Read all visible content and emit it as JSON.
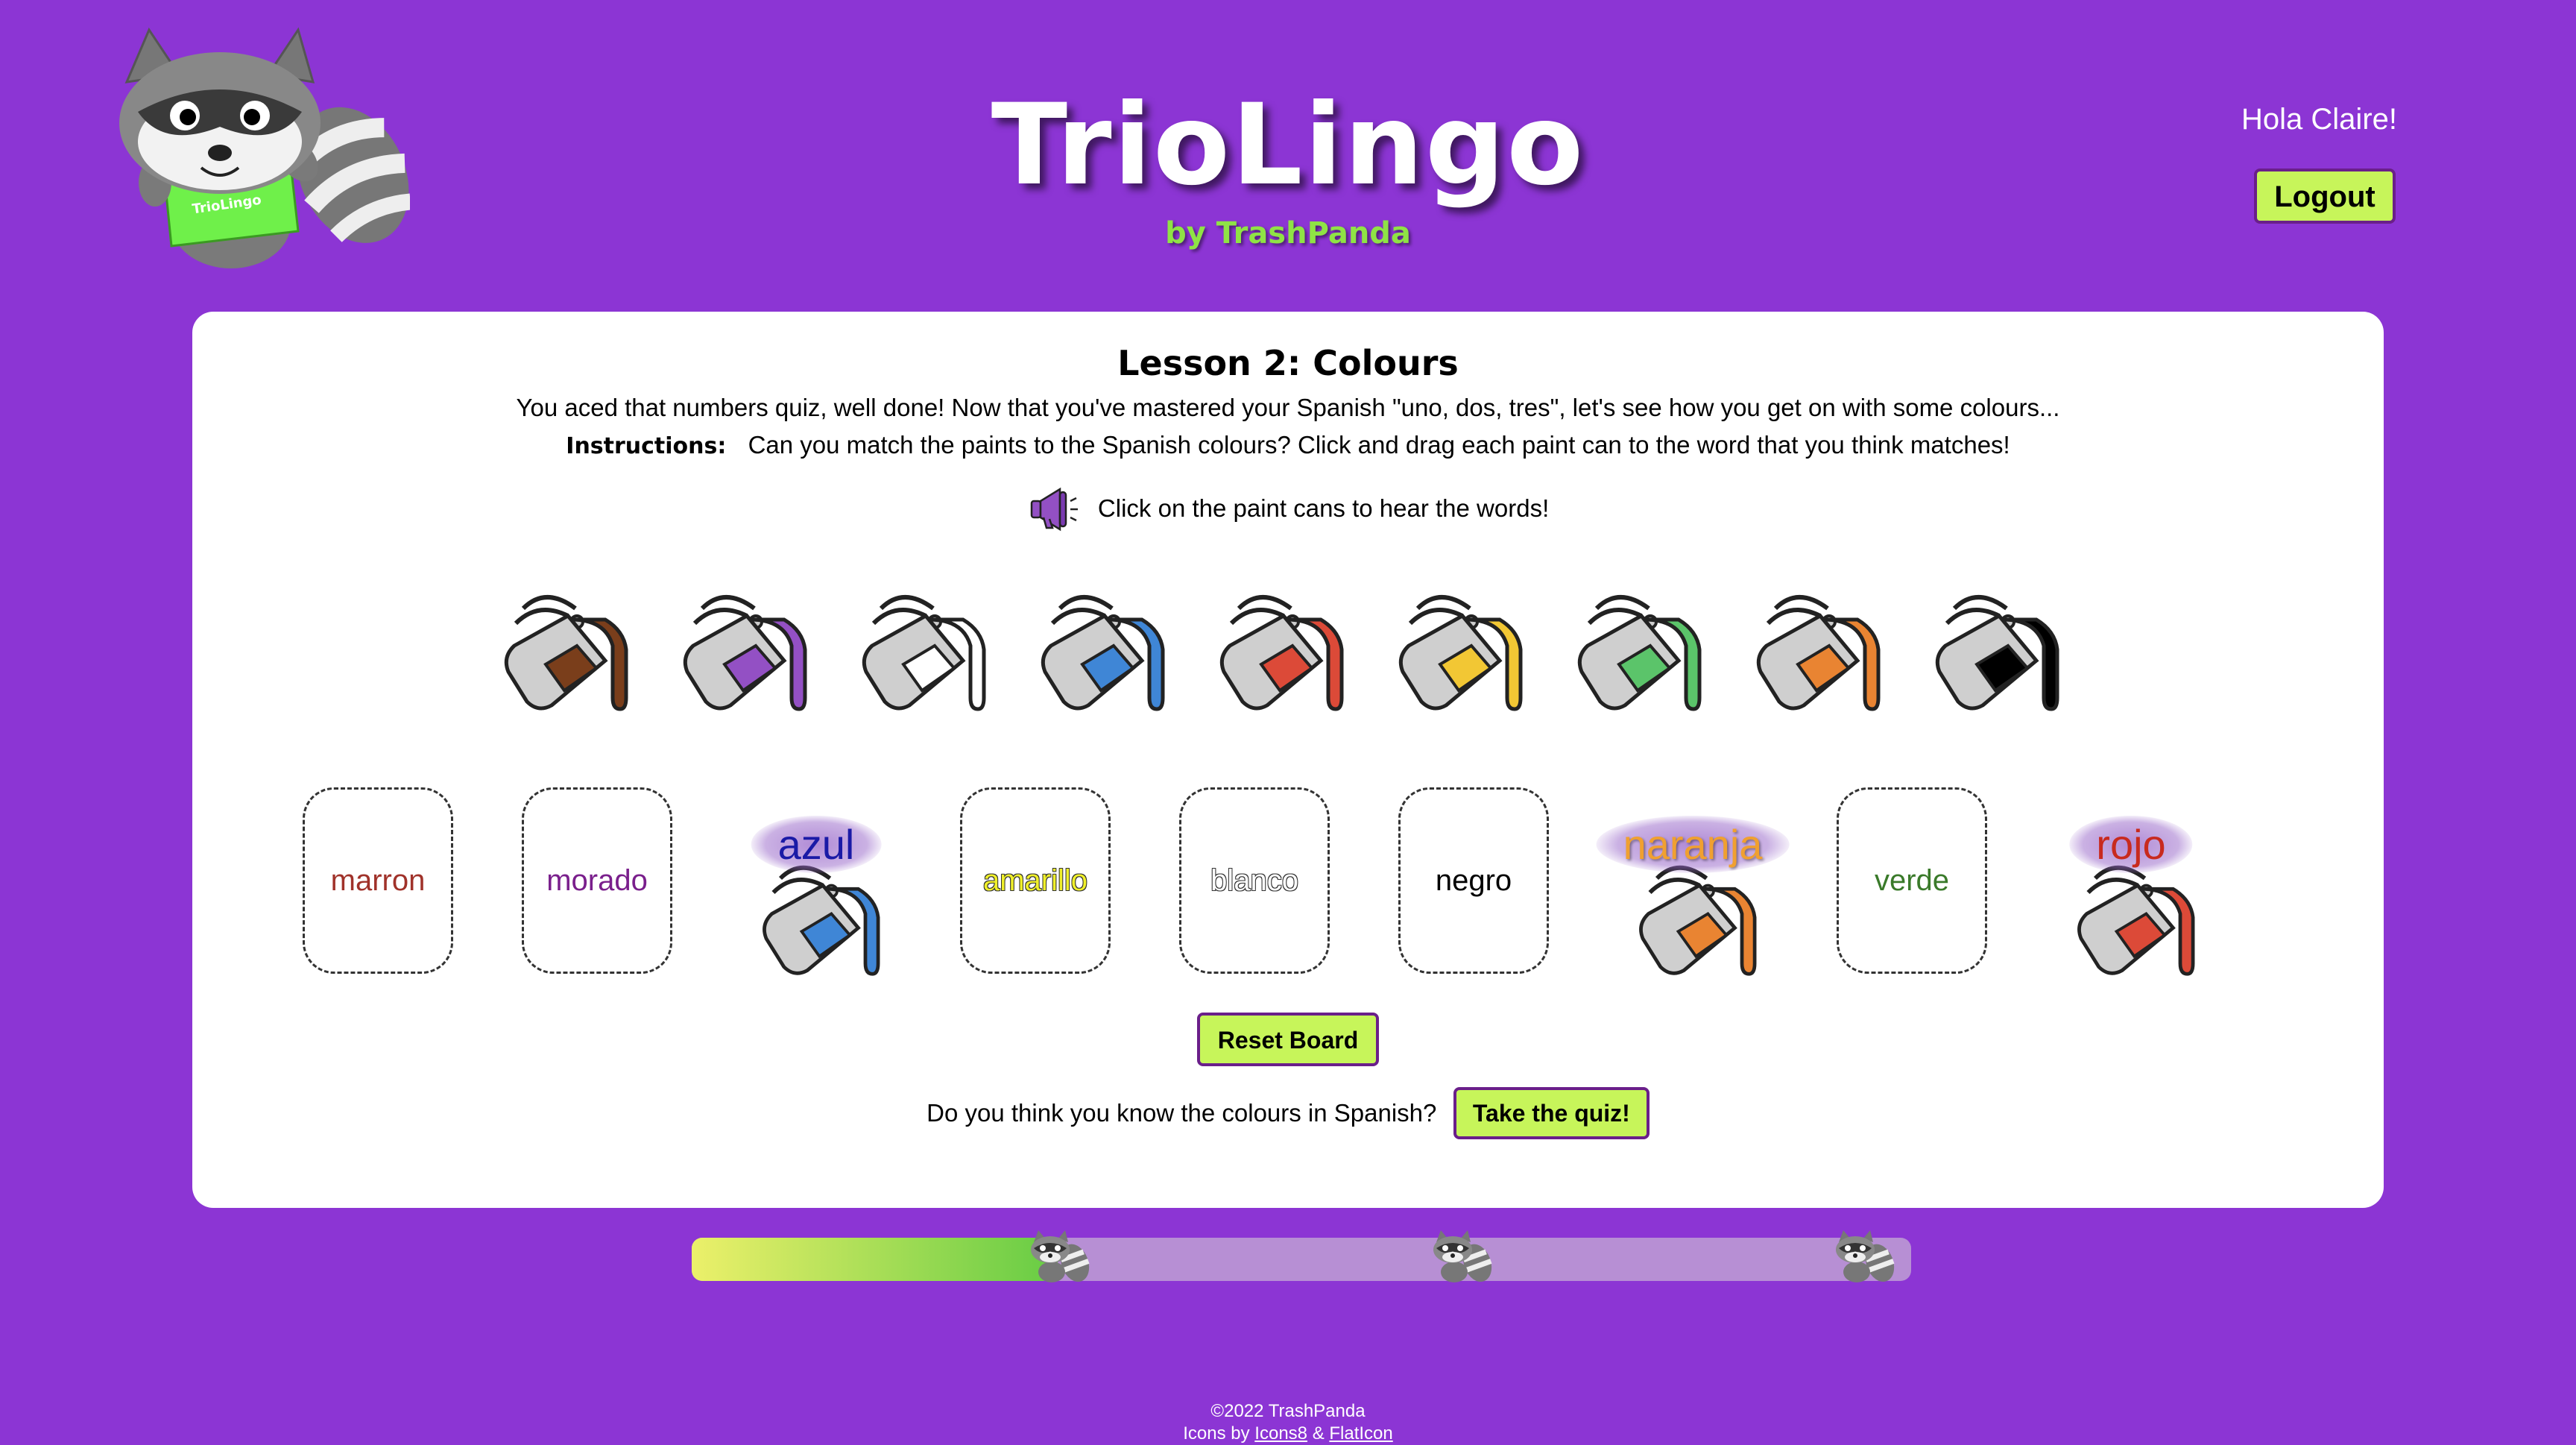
{
  "header": {
    "title": "TrioLingo",
    "subtitle": "by TrashPanda",
    "mascot_shirt_text": "TrioLingo",
    "greeting": "Hola Claire!",
    "logout_label": "Logout"
  },
  "lesson": {
    "title": "Lesson 2: Colours",
    "intro": "You aced that numbers quiz, well done! Now that you've mastered your Spanish \"uno, dos, tres\", let's see how you get on with some colours...",
    "instructions_label": "Instructions:",
    "instructions_text": "Can you match the paints to the Spanish colours? Click and drag each paint can to the word that you think matches!",
    "audio_hint": "Click on the paint cans to hear the words!"
  },
  "paint_cans": [
    {
      "color": "brown",
      "hex": "#7a3e1b",
      "icon": "paint-can-icon"
    },
    {
      "color": "purple",
      "hex": "#9350c4",
      "icon": "paint-can-icon"
    },
    {
      "color": "white",
      "hex": "#ffffff",
      "icon": "paint-can-icon"
    },
    {
      "color": "blue",
      "hex": "#3f86d6",
      "icon": "paint-can-icon"
    },
    {
      "color": "red",
      "hex": "#dc4a38",
      "icon": "paint-can-icon"
    },
    {
      "color": "yellow",
      "hex": "#f2c734",
      "icon": "paint-can-icon"
    },
    {
      "color": "green",
      "hex": "#5bc46a",
      "icon": "paint-can-icon"
    },
    {
      "color": "orange",
      "hex": "#e98432",
      "icon": "paint-can-icon"
    },
    {
      "color": "black",
      "hex": "#000000",
      "icon": "paint-can-icon"
    }
  ],
  "targets": [
    {
      "word": "marron",
      "word_color": "#a0322a",
      "filled": false
    },
    {
      "word": "morado",
      "word_color": "#7a1f8c",
      "filled": false
    },
    {
      "word": "azul",
      "word_color": "#1a1aa6",
      "filled": true,
      "can_hex": "#3f86d6"
    },
    {
      "word": "amarillo",
      "word_color": "#f0f02a",
      "filled": false
    },
    {
      "word": "blanco",
      "word_color": "#ffffff",
      "filled": false
    },
    {
      "word": "negro",
      "word_color": "#000000",
      "filled": false
    },
    {
      "word": "naranja",
      "word_color": "#f0a030",
      "filled": true,
      "can_hex": "#e98432"
    },
    {
      "word": "verde",
      "word_color": "#3a7a2a",
      "filled": false
    },
    {
      "word": "rojo",
      "word_color": "#c82a1e",
      "filled": true,
      "can_hex": "#dc4a38"
    }
  ],
  "actions": {
    "reset_label": "Reset Board",
    "quiz_prompt": "Do you think you know the colours in Spanish?",
    "quiz_label": "Take the quiz!"
  },
  "progress": {
    "fraction": 0.3,
    "milestones": 3
  },
  "footer": {
    "copyright": "©2022 TrashPanda",
    "icons_prefix": "Icons by",
    "link1": "Icons8",
    "amp": "&",
    "link2": "FlatIcon"
  },
  "colors": {
    "background": "#8c35d4",
    "button": "#c7f55a",
    "button_border": "#6a1f8a",
    "progress_start": "#ecf06a",
    "progress_end": "#66cc44",
    "progress_track": "#b78fd4"
  }
}
